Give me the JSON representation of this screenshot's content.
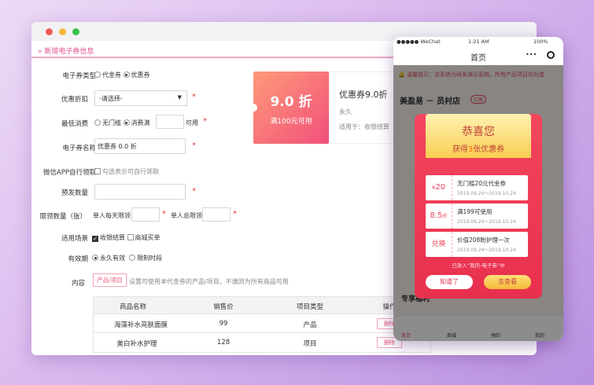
{
  "admin": {
    "header_title": "» 新增电子券信息",
    "type": {
      "label": "电子券类型",
      "opt1": "代金券",
      "opt2": "优惠券"
    },
    "discount": {
      "label": "优惠折扣",
      "placeholder": "-请选择-"
    },
    "min_spend": {
      "label": "最低消费",
      "opt1": "无门槛",
      "opt2": "消费满",
      "unit": "可用"
    },
    "name": {
      "label": "电子券名称",
      "value": "优惠券 0.0 折"
    },
    "app_claim": {
      "label": "微信APP自行领取",
      "text": "勾选表示可自行领取"
    },
    "pre_issue": {
      "label": "预发数量"
    },
    "limit": {
      "label": "限领数量（张）",
      "per_day": "单人每天限领",
      "total": "单人总限领"
    },
    "scene": {
      "label": "适用场景",
      "opt1": "收银结算",
      "opt2": "商城买单"
    },
    "validity": {
      "label": "有效期",
      "opt1": "永久有效",
      "opt2": "限制时段"
    },
    "content": {
      "label": "内容",
      "button": "产品/项目",
      "hint": "设置可使用本代金券的产品/项目，不填则为所有商品可用"
    },
    "table": {
      "headers": [
        "商品名称",
        "销售价",
        "项目类型",
        "操作"
      ],
      "rows": [
        {
          "name": "海藻补水亮肤面膜",
          "price": "99",
          "type": "产品",
          "action": "删除"
        },
        {
          "name": "美白补水护理",
          "price": "128",
          "type": "项目",
          "action": "删除"
        }
      ]
    },
    "preview": {
      "value": "9.0 折",
      "condition": "满100元可用",
      "title": "优惠券9.0折",
      "validity": "永久",
      "scope": "适用于：收银结算"
    }
  },
  "phone": {
    "status_carrier": "●●●●● WeChat",
    "status_time": "1:21 AM",
    "status_battery": "100%",
    "nav_title": "首页",
    "nav_more": "•••",
    "notice": "温馨提示：该系统为研发演示系统，所有产品项目均为虚",
    "shop_name": "美盈易 － 员村店",
    "shop_tag": "切换",
    "section_label": "专享福利",
    "popup": {
      "title": "恭喜您",
      "subtitle_pre": "获得",
      "subtitle_num": "3",
      "subtitle_post": "张优惠券",
      "footer": "已放入“我的-电子券”中",
      "btn_ok": "知道了",
      "btn_view": "去查看",
      "coupons": [
        {
          "value": "20",
          "prefix": "¥",
          "title": "无门槛20元代金券",
          "date": "2019.09.24～2019.10.24"
        },
        {
          "value": "8.5",
          "suffix": "折",
          "title": "满199可使用",
          "date": "2019.09.24～2019.10.24"
        },
        {
          "value": "兑换",
          "title": "价值208盼护理一次",
          "date": "2019.09.24～2019.10.24"
        }
      ]
    },
    "tabs": [
      "首页",
      "商城",
      "预约",
      "我的"
    ]
  }
}
